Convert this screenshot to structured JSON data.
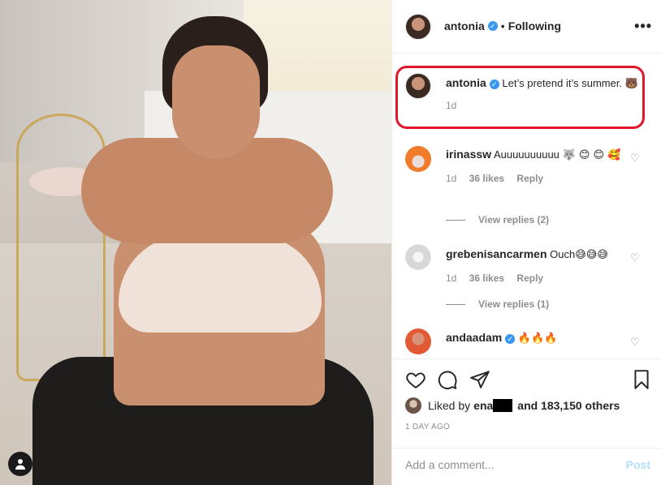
{
  "post": {
    "author": "antonia",
    "following_label": "Following",
    "more_label": "•••"
  },
  "caption": {
    "username": "antonia",
    "text": "Let’s pretend it’s summer.",
    "emoji": "🐻",
    "age": "1d"
  },
  "comments": [
    {
      "username": "irinassw",
      "text": "Auuuuuuuuuu",
      "emoji": "🐺 😊 😊 🥰",
      "age": "1d",
      "likes": "36 likes",
      "reply": "Reply",
      "view_replies": "View replies (2)"
    },
    {
      "username": "grebenisancarmen",
      "text": "Ouch",
      "emoji": "😅😅😅",
      "age": "1d",
      "likes": "36 likes",
      "reply": "Reply",
      "view_replies": "View replies (1)"
    },
    {
      "username": "andaadam",
      "text": "",
      "emoji": "🔥🔥🔥"
    }
  ],
  "likes": {
    "prefix": "Liked by",
    "name_visible": "ena",
    "suffix": "and 183,150 others",
    "time_ago": "1 DAY AGO"
  },
  "add_comment": {
    "placeholder": "Add a comment...",
    "post_label": "Post"
  },
  "colors": {
    "verified": "#3897f0",
    "highlight_box": "#e0162b",
    "post_button": "#b2dffc"
  }
}
